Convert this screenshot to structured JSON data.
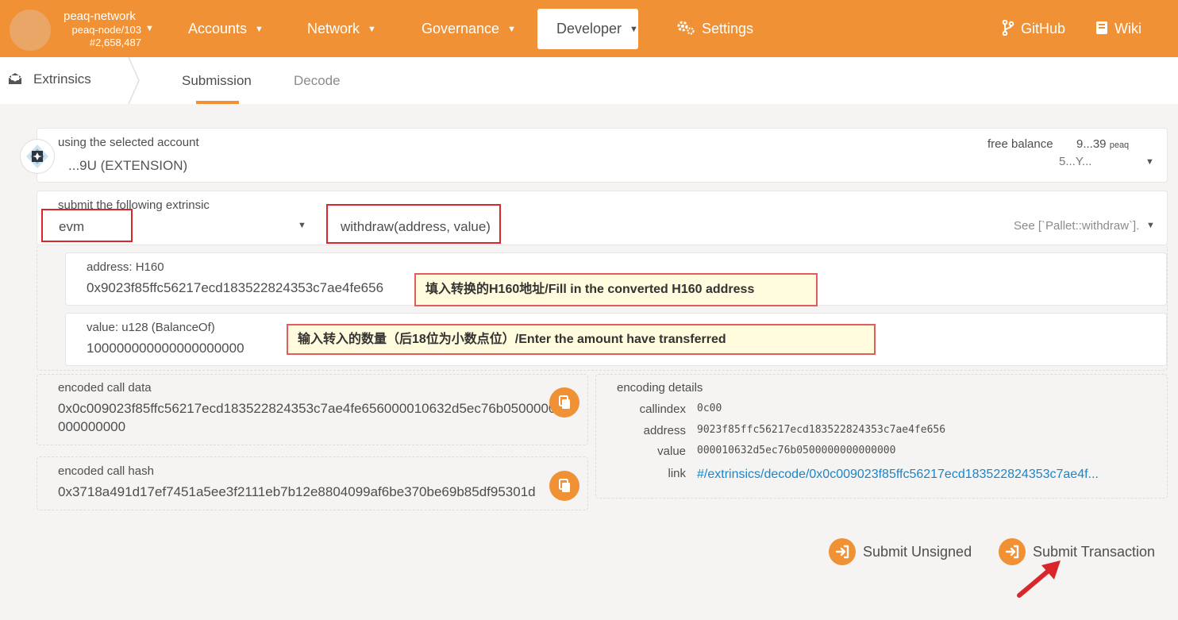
{
  "header": {
    "node_name": "peaq-network",
    "node_version": "peaq-node/103",
    "block_number": "#2,658,487",
    "nav": [
      {
        "label": "Accounts",
        "icon": "chevron-down-icon"
      },
      {
        "label": "Network",
        "icon": "chevron-down-icon"
      },
      {
        "label": "Governance",
        "icon": "chevron-down-icon"
      },
      {
        "label": "Developer",
        "icon": "chevron-down-icon",
        "active": true
      },
      {
        "label": "Settings",
        "icon": "gears-icon"
      }
    ],
    "github_label": "GitHub",
    "wiki_label": "Wiki"
  },
  "subnav": {
    "section": "Extrinsics",
    "tabs": [
      {
        "label": "Submission",
        "active": true
      },
      {
        "label": "Decode",
        "active": false
      }
    ]
  },
  "account": {
    "label": "using the selected account",
    "name": "...9U (EXTENSION)",
    "free_balance_label": "free balance",
    "free_balance_value": "9...39",
    "free_balance_unit": "peaq",
    "address_short": "5...Y..."
  },
  "extrinsic": {
    "label": "submit the following extrinsic",
    "pallet": "evm",
    "method": "withdraw(address, value)",
    "docs": "See [`Pallet::withdraw`]."
  },
  "params": [
    {
      "label": "address: H160",
      "value": "0x9023f85ffc56217ecd183522824353c7ae4fe656"
    },
    {
      "label": "value: u128 (BalanceOf)",
      "value": "100000000000000000000"
    }
  ],
  "annotations": {
    "address_note": "填入转换的H160地址/Fill in the converted H160 address",
    "value_note": "输入转入的数量（后18位为小数点位）/Enter the amount have transferred"
  },
  "encoded_call_data": {
    "label": "encoded call data",
    "line1": "0x0c009023f85ffc56217ecd183522824353c7ae4fe656000010632d5ec76b0500000",
    "line2": "000000000"
  },
  "encoded_call_hash": {
    "label": "encoded call hash",
    "value": "0x3718a491d17ef7451a5ee3f2111eb7b12e8804099af6be370be69b85df95301d"
  },
  "encoding_details": {
    "label": "encoding details",
    "rows": [
      {
        "key": "callindex",
        "value": "0c00"
      },
      {
        "key": "address",
        "value": "9023f85ffc56217ecd183522824353c7ae4fe656"
      },
      {
        "key": "value",
        "value": "000010632d5ec76b0500000000000000"
      },
      {
        "key": "link",
        "value": "#/extrinsics/decode/0x0c009023f85ffc56217ecd183522824353c7ae4f..."
      }
    ]
  },
  "actions": {
    "submit_unsigned": "Submit Unsigned",
    "submit_transaction": "Submit Transaction"
  },
  "colors": {
    "accent": "#f19135",
    "annotation_red": "#d9262b",
    "link": "#1c85c8"
  }
}
